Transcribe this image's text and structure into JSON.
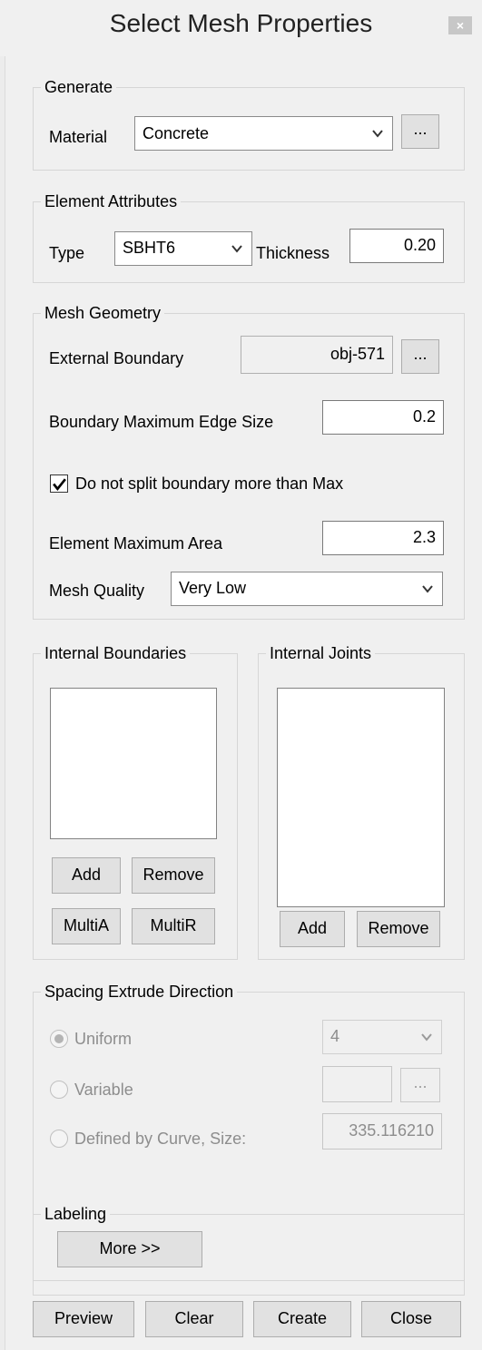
{
  "window": {
    "title": "Select Mesh Properties",
    "close_glyph": "×"
  },
  "generate": {
    "legend": "Generate",
    "material_label": "Material",
    "material_value": "Concrete",
    "ellipsis_label": "..."
  },
  "element_attributes": {
    "legend": "Element Attributes",
    "type_label": "Type",
    "type_value": "SBHT6",
    "thickness_label": "Thickness",
    "thickness_value": "0.20"
  },
  "mesh_geometry": {
    "legend": "Mesh Geometry",
    "external_boundary_label": "External Boundary",
    "external_boundary_value": "obj-571",
    "ellipsis_label": "...",
    "max_edge_label": "Boundary Maximum Edge Size",
    "max_edge_value": "0.2",
    "no_split_label": "Do not split boundary more than Max",
    "no_split_checked": true,
    "max_area_label": "Element Maximum Area",
    "max_area_value": "2.3",
    "quality_label": "Mesh Quality",
    "quality_value": "Very Low"
  },
  "internal_boundaries": {
    "legend": "Internal Boundaries",
    "add_label": "Add",
    "remove_label": "Remove",
    "multia_label": "MultiA",
    "multir_label": "MultiR"
  },
  "internal_joints": {
    "legend": "Internal Joints",
    "add_label": "Add",
    "remove_label": "Remove"
  },
  "spacing": {
    "legend": "Spacing Extrude Direction",
    "uniform_label": "Uniform",
    "uniform_value": "4",
    "variable_label": "Variable",
    "ellipsis_label": "...",
    "curve_label": "Defined by Curve, Size:",
    "curve_value": "335.116210"
  },
  "labeling": {
    "legend": "Labeling",
    "more_label": "More >>"
  },
  "footer": {
    "preview_label": "Preview",
    "clear_label": "Clear",
    "create_label": "Create",
    "close_label": "Close"
  },
  "colors": {
    "background": "#f0f0f0",
    "disabled_text": "#8d8d8d"
  }
}
